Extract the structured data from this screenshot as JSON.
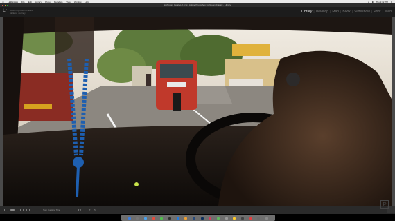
{
  "menubar": {
    "app_name": "Lightroom",
    "items": [
      "File",
      "Edit",
      "Library",
      "Photo",
      "Metadata",
      "View",
      "Window",
      "Help"
    ],
    "clock": "Thu 2:32 PM"
  },
  "window": {
    "title": "Lightroom Catalog-2.lrcat - Adobe Photoshop Lightroom Classic - Library"
  },
  "identity": {
    "logo": "Lr",
    "line1": "Adobe Lightroom Classic",
    "line2": "Mellerss Journey"
  },
  "modules": {
    "items": [
      "Library",
      "Develop",
      "Map",
      "Book",
      "Slideshow",
      "Print",
      "Web"
    ],
    "separator": "|",
    "active": "Library"
  },
  "toolbar": {
    "sort_label": "Sort: Capture Time"
  },
  "watermark": "P",
  "colors": {
    "menubar_bg": "#e9e9e9",
    "titlebar_bg": "#2b2b2b",
    "module_active": "#e6e6e6",
    "module_inactive": "#7a7a7a",
    "workarea_bg": "#4a4a4a",
    "toolbar_bg": "#2a2a2a",
    "tuktuk_red": "#c0392b",
    "bead_blue": "#1e5fb0",
    "shop_yellow": "#e0b23c"
  }
}
